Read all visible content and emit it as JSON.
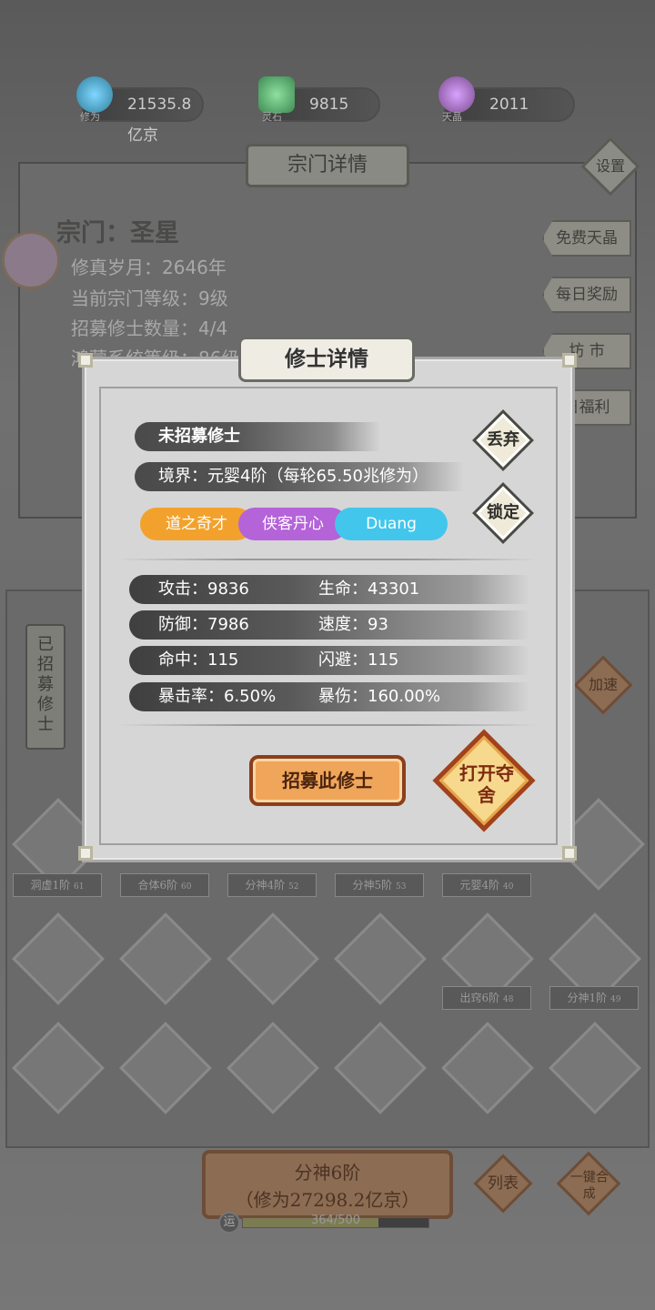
{
  "resources": [
    {
      "value": "21535.8亿京",
      "caption": "修为",
      "color": "#2f7f9a"
    },
    {
      "value": "9815",
      "caption": "灵石",
      "color": "#3d8a52"
    },
    {
      "value": "2011",
      "caption": "天晶",
      "color": "#7a4a8a"
    }
  ],
  "sect": {
    "title": "宗门详情",
    "settings": "设置",
    "name": "宗门：圣星",
    "lines": [
      "修真岁月：2646年",
      "当前宗门等级：9级",
      "招募修士数量：4/4",
      "鸿蒙系统等级：86级"
    ],
    "side_buttons": [
      "免费天晶",
      "每日奖励",
      "坊 市",
      "日福利"
    ]
  },
  "recruited_label": "已招募修士",
  "speed_label": "加速",
  "grid_labels": [
    {
      "text": "洞虚1阶",
      "num": "61"
    },
    {
      "text": "合体6阶",
      "num": "60"
    },
    {
      "text": "分神4阶",
      "num": "52"
    },
    {
      "text": "分神5阶",
      "num": "53"
    },
    {
      "text": "元婴4阶",
      "num": "40"
    },
    {
      "text": "出窍6阶",
      "num": "48"
    },
    {
      "text": "分神1阶",
      "num": "49"
    }
  ],
  "bottom": {
    "main_line1": "分神6阶",
    "main_line2": "（修为27298.2亿京）",
    "list": "列表",
    "merge": "一键合成",
    "luck": "运",
    "progress_text": "364/500",
    "progress": 0.728
  },
  "modal": {
    "title": "修士详情",
    "status": "未招募修士",
    "realm": "境界：元婴4阶（每轮65.50兆修为）",
    "discard": "丢弃",
    "lock": "锁定",
    "tags": [
      {
        "text": "道之奇才",
        "color": "#f2a22c"
      },
      {
        "text": "侠客丹心",
        "color": "#b463d8"
      },
      {
        "text": "Duang",
        "color": "#43c6ec"
      }
    ],
    "stats": [
      {
        "left": "攻击：9836",
        "right": "生命：43301"
      },
      {
        "left": "防御：7986",
        "right": "速度：93"
      },
      {
        "left": "命中：115",
        "right": "闪避：115"
      },
      {
        "left": "暴击率：6.50%",
        "right": "暴伤：160.00%"
      }
    ],
    "recruit": "招募此修士",
    "open": "打开夺舍"
  }
}
